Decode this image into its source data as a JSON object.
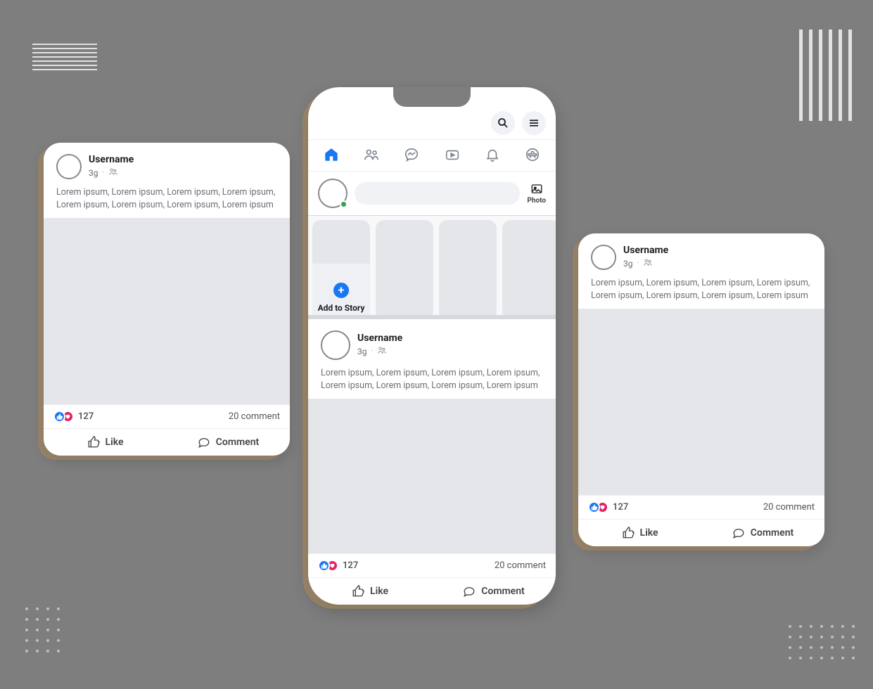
{
  "post": {
    "username": "Username",
    "time": "3g",
    "text": "Lorem ipsum, Lorem ipsum, Lorem ipsum, Lorem ipsum, Lorem ipsum, Lorem ipsum, Lorem ipsum, Lorem ipsum",
    "reaction_count": "127",
    "comment_count": "20 comment",
    "like_label": "Like",
    "comment_label": "Comment"
  },
  "composer": {
    "photo_label": "Photo"
  },
  "stories": {
    "add_label": "Add to Story"
  }
}
